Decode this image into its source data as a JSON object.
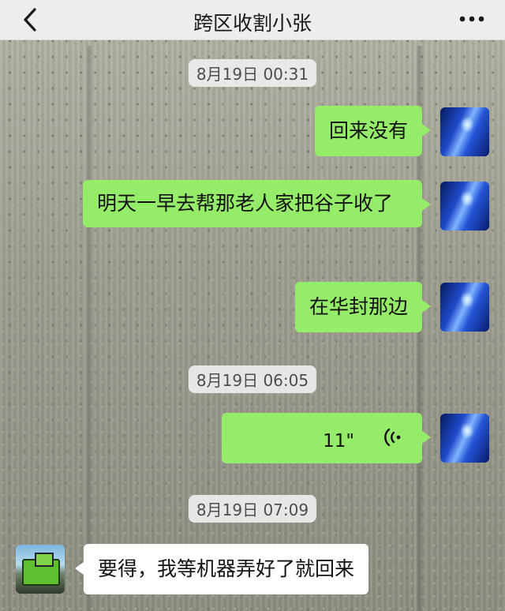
{
  "header": {
    "title": "跨区收割小张",
    "back_icon": "chevron-left-icon",
    "more_icon": "more-horizontal-icon"
  },
  "messages": [
    {
      "type": "timestamp",
      "text": "8月19日 00:31"
    },
    {
      "type": "text",
      "side": "right",
      "text": "回来没有"
    },
    {
      "type": "text",
      "side": "right",
      "text": "明天一早去帮那老人家把谷子收了"
    },
    {
      "type": "text",
      "side": "right",
      "text": "在华封那边"
    },
    {
      "type": "timestamp",
      "text": "8月19日 06:05"
    },
    {
      "type": "voice",
      "side": "right",
      "duration": "11\""
    },
    {
      "type": "timestamp",
      "text": "8月19日 07:09"
    },
    {
      "type": "text",
      "side": "left",
      "text": "要得，我等机器弄好了就回来"
    }
  ],
  "colors": {
    "sent_bubble": "#95ec69",
    "received_bubble": "#ffffff",
    "nav_bg": "#ededed"
  }
}
